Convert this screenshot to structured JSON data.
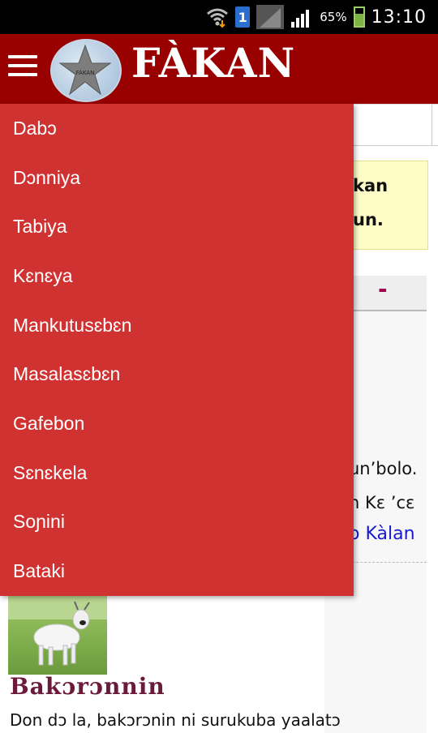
{
  "status_bar": {
    "sim_slot": "1",
    "battery_percent": "65%",
    "time": "13:10"
  },
  "app_bar": {
    "title": "FÀKAN",
    "logo_text": "FÀKAN"
  },
  "drawer": {
    "items": [
      {
        "label": "Dabɔ"
      },
      {
        "label": "Dɔnniya"
      },
      {
        "label": "Tabiya"
      },
      {
        "label": "Kɛnɛya"
      },
      {
        "label": "Mankutusɛbɛn"
      },
      {
        "label": "Masalasɛbɛn"
      },
      {
        "label": "Gafebon"
      },
      {
        "label": "Sɛnɛkela"
      },
      {
        "label": "Soɲini"
      },
      {
        "label": "Bataki"
      }
    ]
  },
  "background": {
    "notice_line1": "kan",
    "notice_line2": "un.",
    "collapse_symbol": "-",
    "line1": "un’bolo.",
    "line2": "n Kɛ ’cɛ",
    "link": "o Kàlan",
    "article_title": "Bakɔrɔnnin",
    "article_text": "Don dɔ la, bakɔrɔnin ni surukuba yaalatɔ"
  }
}
